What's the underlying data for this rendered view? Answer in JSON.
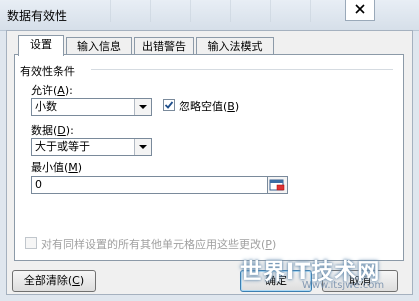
{
  "window": {
    "title": "数据有效性"
  },
  "tabs": [
    {
      "label": "设置",
      "active": true
    },
    {
      "label": "输入信息",
      "active": false
    },
    {
      "label": "出错警告",
      "active": false
    },
    {
      "label": "输入法模式",
      "active": false
    }
  ],
  "settings": {
    "group_label": "有效性条件",
    "allow": {
      "label": "允许",
      "key": "A",
      "value": "小数"
    },
    "ignore_blank": {
      "label": "忽略空值",
      "key": "B",
      "checked": true
    },
    "data": {
      "label": "数据",
      "key": "D",
      "value": "大于或等于"
    },
    "minimum": {
      "label": "最小值",
      "key": "M",
      "value": "0"
    },
    "apply_all": {
      "label": "对有同样设置的所有其他单元格应用这些更改",
      "key": "P",
      "checked": false,
      "enabled": false
    }
  },
  "buttons": {
    "clear_all": {
      "label": "全部清除",
      "key": "C"
    },
    "ok": "确定",
    "cancel": "取消"
  },
  "watermark": {
    "text": "世界IT技术网",
    "subtext": "Www.itsjwe.com"
  },
  "colors": {
    "window_bg": "#dfe6ee",
    "panel_bg": "#ffffff",
    "check_mark": "#1f4e8a",
    "ok_border": "#3c7fb1"
  }
}
